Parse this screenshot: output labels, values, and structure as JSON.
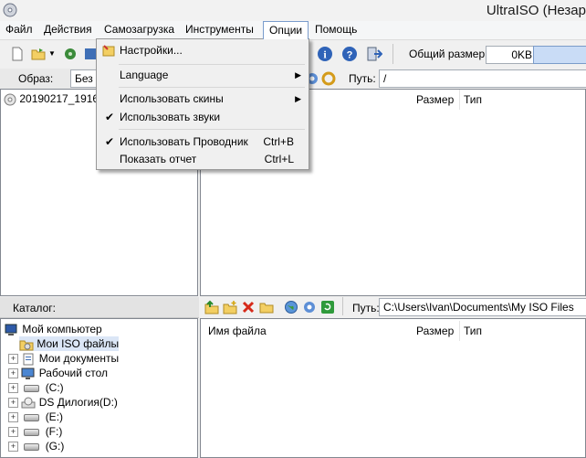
{
  "window": {
    "title": "UltraISO (Незар"
  },
  "menubar": {
    "items": [
      "Файл",
      "Действия",
      "Самозагрузка",
      "Инструменты",
      "Опции",
      "Помощь"
    ],
    "active": "Опции"
  },
  "toolbar": {
    "total_size_label": "Общий размер:",
    "total_size_value": "0KB"
  },
  "image_panel": {
    "label": "Образ:",
    "image_value": "Без",
    "path_label": "Путь:",
    "path_value": "/",
    "tree_item": "20190217_1916",
    "columns": [
      "Размер",
      "Тип"
    ]
  },
  "options_menu": {
    "items": [
      {
        "label": "Настройки...",
        "shortcut": "",
        "check": false,
        "submenu": false
      },
      {
        "label": "Language",
        "shortcut": "",
        "check": false,
        "submenu": true
      },
      {
        "label": "Использовать скины",
        "shortcut": "",
        "check": false,
        "submenu": true
      },
      {
        "label": "Использовать звуки",
        "shortcut": "",
        "check": true,
        "submenu": false
      },
      {
        "label": "Использовать Проводник",
        "shortcut": "Ctrl+B",
        "check": true,
        "submenu": false
      },
      {
        "label": "Показать отчет",
        "shortcut": "Ctrl+L",
        "check": false,
        "submenu": false
      }
    ]
  },
  "catalog_panel": {
    "label": "Каталог:",
    "path_label": "Путь:",
    "path_value": "C:\\Users\\Ivan\\Documents\\My ISO Files",
    "columns": [
      "Имя файла",
      "Размер",
      "Тип"
    ],
    "tree": [
      {
        "label": "Мой компьютер",
        "icon": "computer-icon"
      },
      {
        "label": "Мои ISO файлы",
        "icon": "iso-folder-icon"
      },
      {
        "label": "Мои документы",
        "icon": "documents-icon"
      },
      {
        "label": "Рабочий стол",
        "icon": "desktop-icon"
      },
      {
        "label": "(C:)",
        "icon": "drive-icon"
      },
      {
        "label": "DS Дилогия(D:)",
        "icon": "cd-drive-icon"
      },
      {
        "label": "(E:)",
        "icon": "drive-icon"
      },
      {
        "label": "(F:)",
        "icon": "drive-icon"
      },
      {
        "label": "(G:)",
        "icon": "drive-icon"
      }
    ]
  }
}
